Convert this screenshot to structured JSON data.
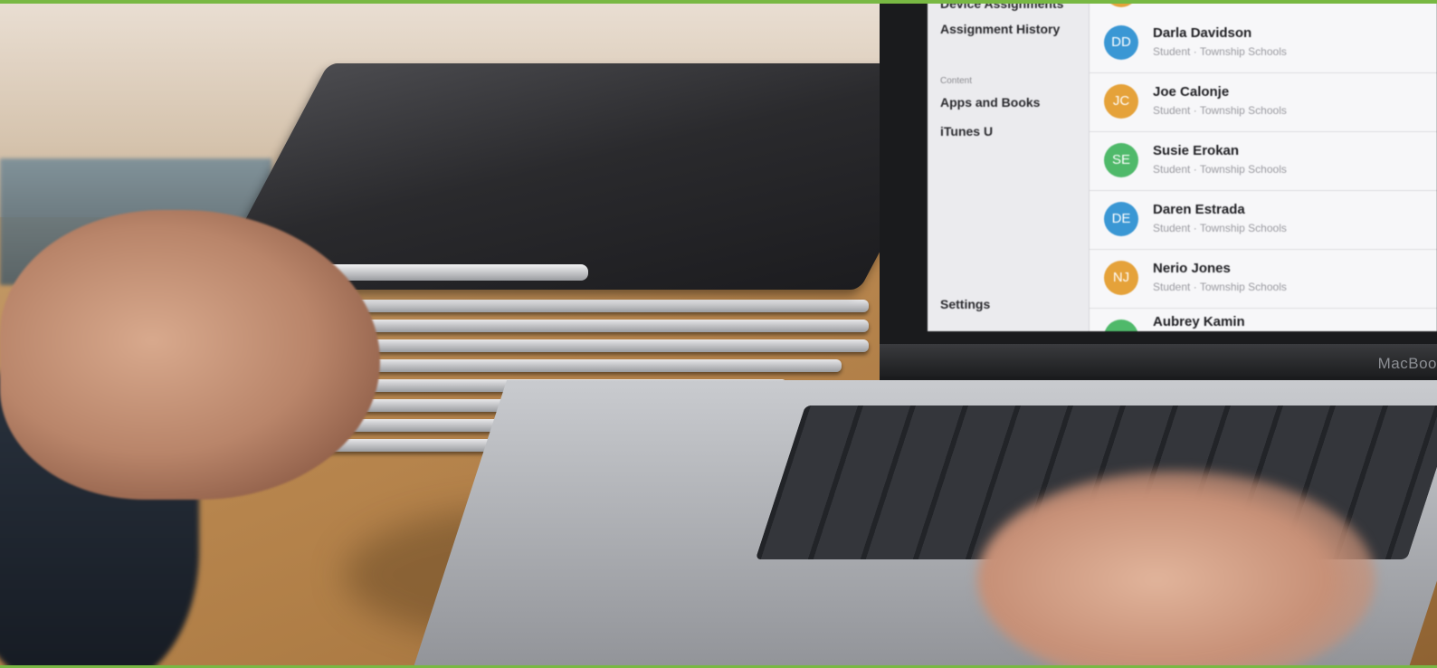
{
  "screen": {
    "sidebar": {
      "items_top": [
        "Device Assignments",
        "Assignment History"
      ],
      "section_label": "Content",
      "content_items": [
        "Apps and Books",
        "iTunes U"
      ],
      "settings_label": "Settings"
    },
    "people": [
      {
        "initials": "DD",
        "name": "Darla Davidson",
        "subtitle": "Student · Township Schools",
        "color": "#3a97d4"
      },
      {
        "initials": "JC",
        "name": "Joe Calonje",
        "subtitle": "Student · Township Schools",
        "color": "#e5a23a"
      },
      {
        "initials": "SE",
        "name": "Susie Erokan",
        "subtitle": "Student · Township Schools",
        "color": "#4fb96a"
      },
      {
        "initials": "DE",
        "name": "Daren Estrada",
        "subtitle": "Student · Township Schools",
        "color": "#3a97d4"
      },
      {
        "initials": "NJ",
        "name": "Nerio Jones",
        "subtitle": "Student · Township Schools",
        "color": "#e5a23a"
      },
      {
        "initials": "",
        "name": "Aubrey Kamin",
        "subtitle": "",
        "color": "#4fb96a"
      }
    ]
  },
  "laptop": {
    "brand": "MacBoo"
  },
  "colors": {
    "accent": "#78b843"
  }
}
